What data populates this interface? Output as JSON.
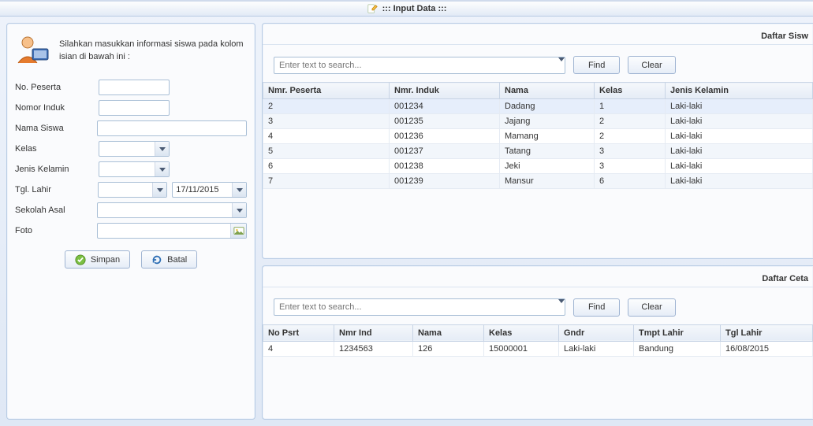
{
  "window": {
    "title": "::: Input Data :::"
  },
  "form": {
    "intro": "Silahkan masukkan informasi siswa pada kolom isian di bawah ini :",
    "labels": {
      "no_peserta": "No. Peserta",
      "nomor_induk": "Nomor Induk",
      "nama_siswa": "Nama Siswa",
      "kelas": "Kelas",
      "jenis_kelamin": "Jenis Kelamin",
      "tgl_lahir": "Tgl. Lahir",
      "sekolah_asal": "Sekolah Asal",
      "foto": "Foto"
    },
    "values": {
      "no_peserta": "",
      "nomor_induk": "",
      "nama_siswa": "",
      "kelas": "",
      "jenis_kelamin": "",
      "tgl_lahir_left": "",
      "tgl_lahir_right": "17/11/2015",
      "sekolah_asal": "",
      "foto": ""
    },
    "buttons": {
      "save": "Simpan",
      "cancel": "Batal"
    }
  },
  "top_panel": {
    "title": "Daftar Sisw",
    "search_placeholder": "Enter text to search...",
    "find": "Find",
    "clear": "Clear",
    "columns": [
      "Nmr. Peserta",
      "Nmr. Induk",
      "Nama",
      "Kelas",
      "Jenis Kelamin"
    ],
    "rows": [
      [
        "2",
        "001234",
        "Dadang",
        "1",
        "Laki-laki"
      ],
      [
        "3",
        "001235",
        "Jajang",
        "2",
        "Laki-laki"
      ],
      [
        "4",
        "001236",
        "Mamang",
        "2",
        "Laki-laki"
      ],
      [
        "5",
        "001237",
        "Tatang",
        "3",
        "Laki-laki"
      ],
      [
        "6",
        "001238",
        "Jeki",
        "3",
        "Laki-laki"
      ],
      [
        "7",
        "001239",
        "Mansur",
        "6",
        "Laki-laki"
      ]
    ]
  },
  "bottom_panel": {
    "title": "Daftar Ceta",
    "search_placeholder": "Enter text to search...",
    "find": "Find",
    "clear": "Clear",
    "columns": [
      "No Psrt",
      "Nmr Ind",
      "Nama",
      "Kelas",
      "Gndr",
      "Tmpt Lahir",
      "Tgl Lahir"
    ],
    "rows": [
      [
        "4",
        "1234563",
        "126",
        "15000001",
        "Laki-laki",
        "Bandung",
        "16/08/2015"
      ]
    ]
  }
}
